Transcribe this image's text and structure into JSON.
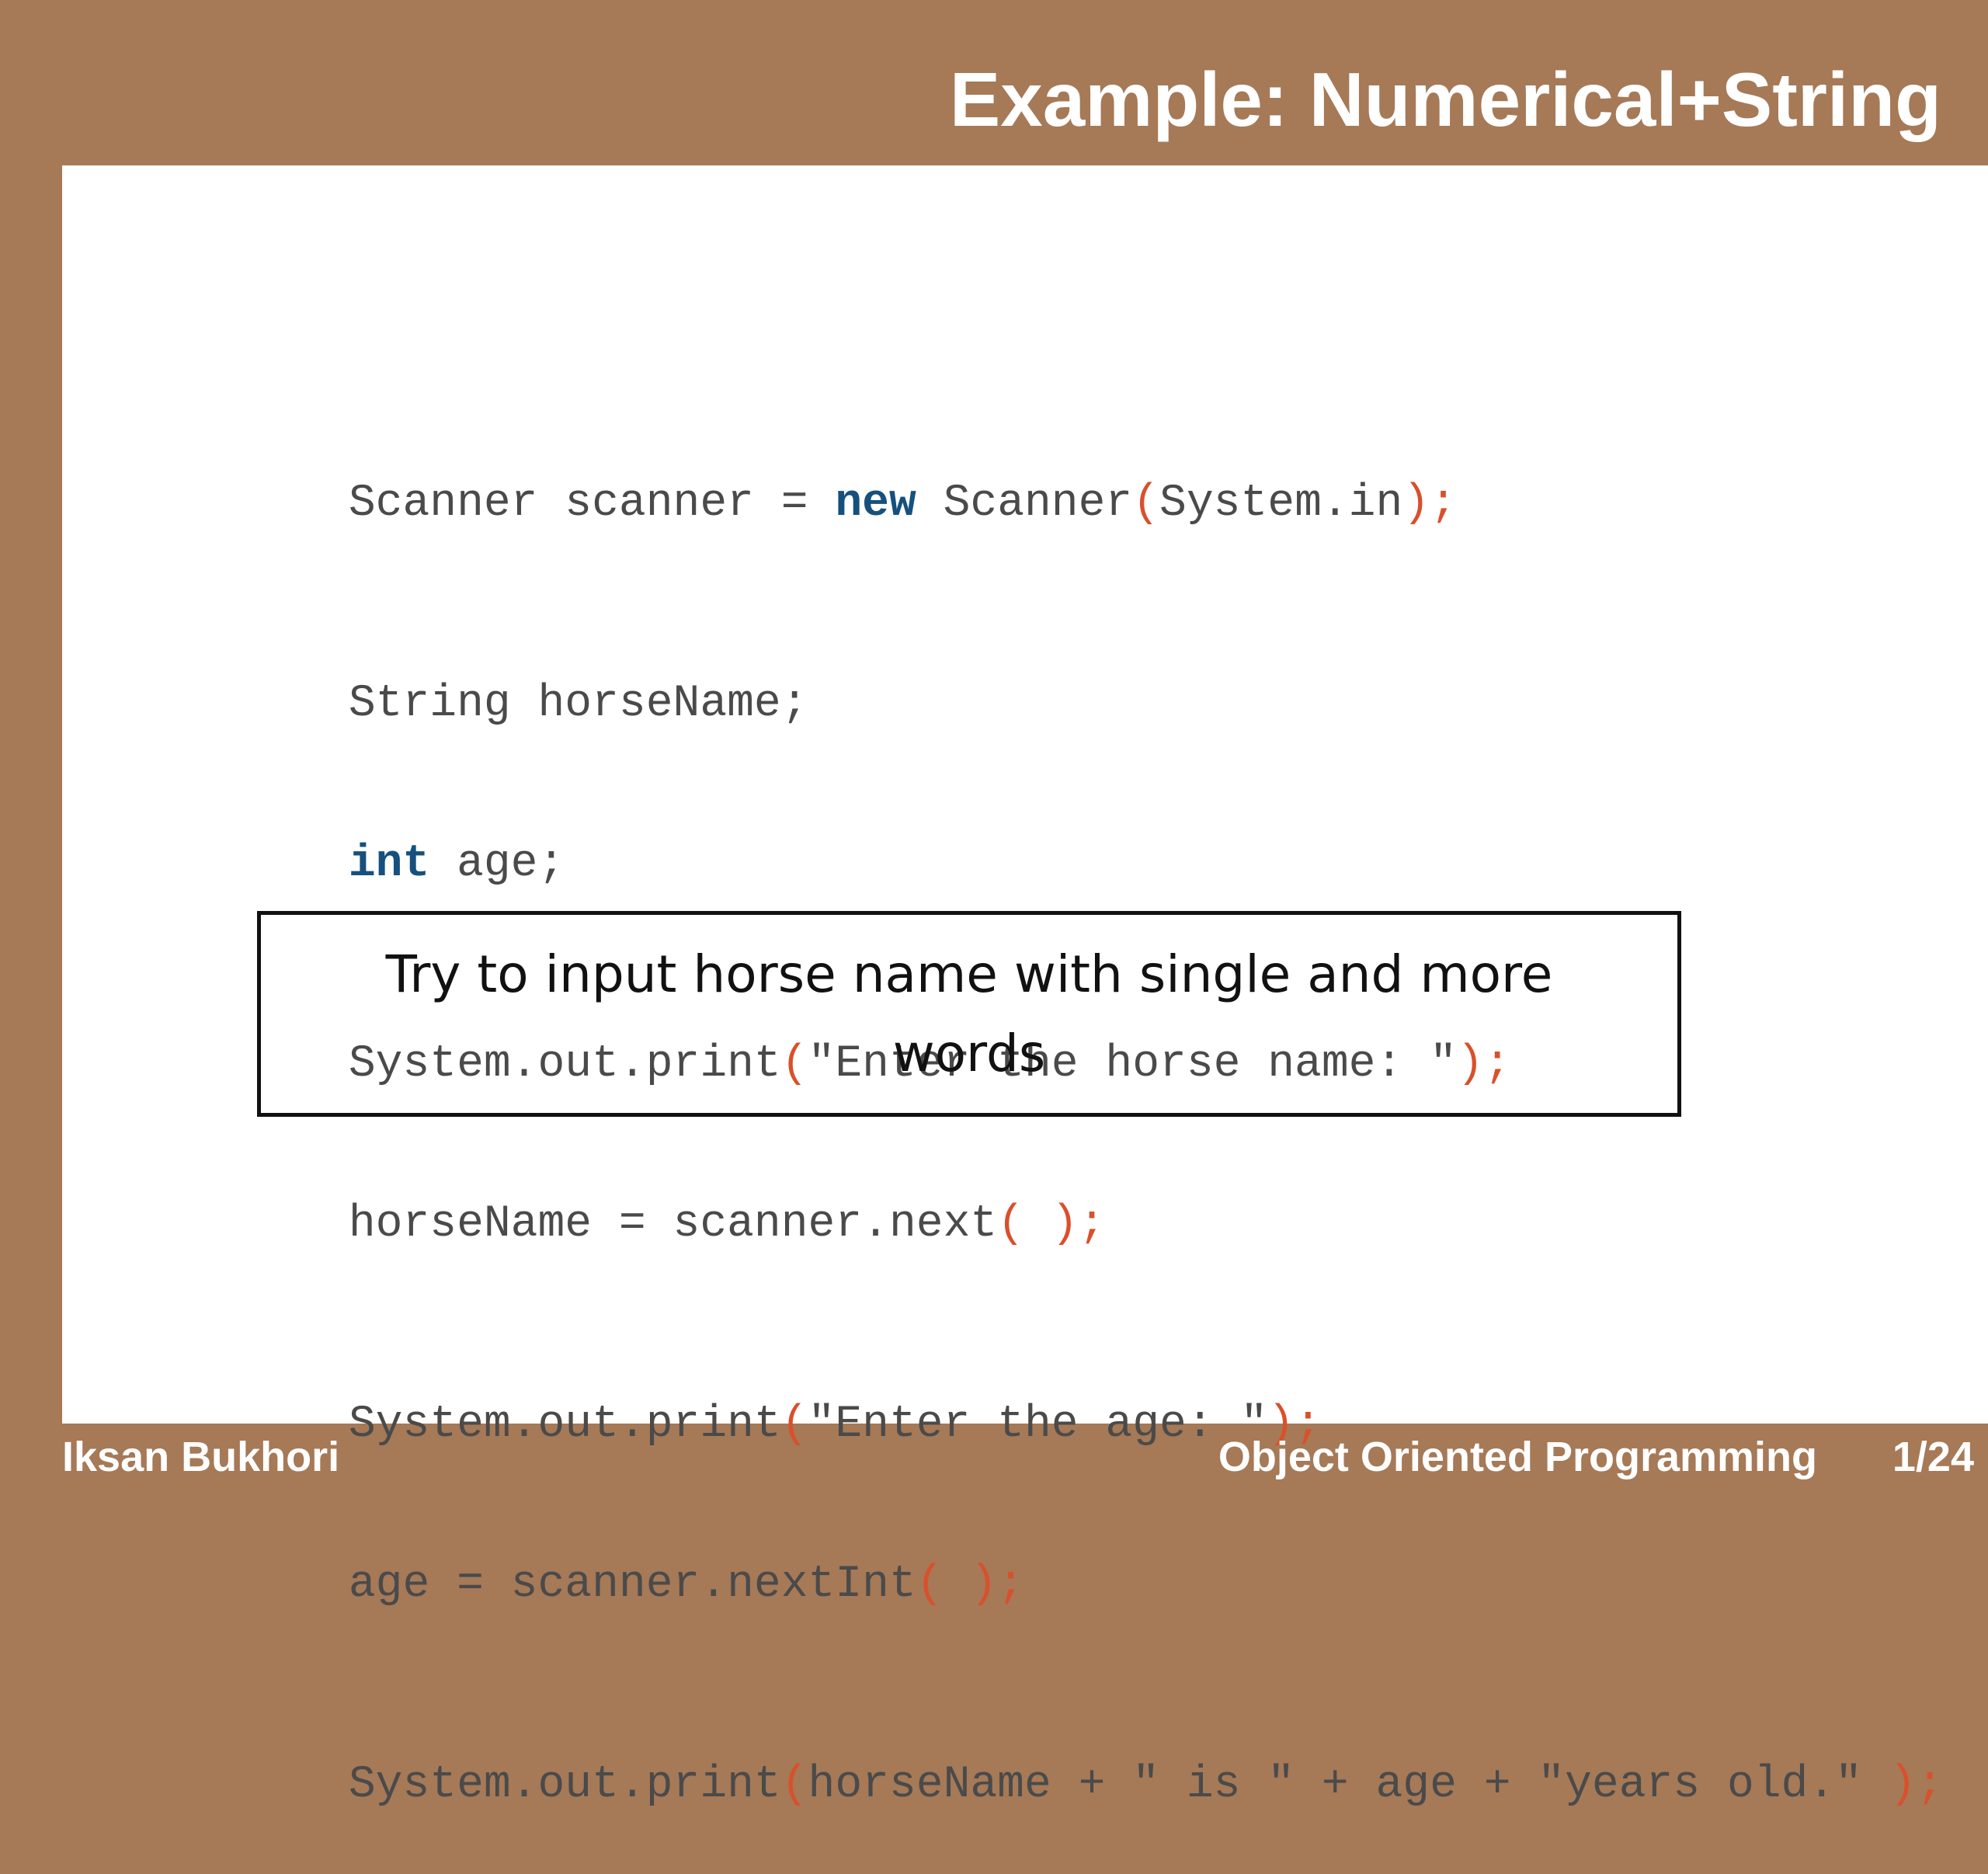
{
  "slide": {
    "title": "Example: Numerical+String"
  },
  "code": {
    "lines": [
      {
        "tokens": [
          {
            "t": "Scanner scanner = ",
            "c": "plain"
          },
          {
            "t": "new",
            "c": "kw"
          },
          {
            "t": " Scanner",
            "c": "plain"
          },
          {
            "t": "(",
            "c": "punc"
          },
          {
            "t": "System.in",
            "c": "plain"
          },
          {
            "t": ");",
            "c": "punc"
          }
        ]
      },
      {
        "tokens": [
          {
            "t": "String horseName;",
            "c": "plain"
          }
        ]
      },
      {
        "tokens": [
          {
            "t": "int",
            "c": "kw"
          },
          {
            "t": " age;",
            "c": "plain"
          }
        ]
      },
      {
        "tokens": [
          {
            "t": "System.out.print",
            "c": "plain"
          },
          {
            "t": "(",
            "c": "punc"
          },
          {
            "t": "\"Enter the horse name: \"",
            "c": "plain"
          },
          {
            "t": ");",
            "c": "punc"
          }
        ]
      },
      {
        "tokens": [
          {
            "t": "horseName = scanner.next",
            "c": "plain"
          },
          {
            "t": "( );",
            "c": "punc"
          }
        ]
      },
      {
        "tokens": [
          {
            "t": "System.out.print",
            "c": "plain"
          },
          {
            "t": "(",
            "c": "punc"
          },
          {
            "t": "\"Enter the age: \"",
            "c": "plain"
          },
          {
            "t": ");",
            "c": "punc"
          }
        ]
      },
      {
        "tokens": [
          {
            "t": "age = scanner.nextInt",
            "c": "plain"
          },
          {
            "t": "( );",
            "c": "punc"
          }
        ]
      },
      {
        "tokens": [
          {
            "t": "System.out.print",
            "c": "plain"
          },
          {
            "t": "(",
            "c": "punc"
          },
          {
            "t": "horseName + \" is \" + age + \"years old.\" ",
            "c": "plain"
          },
          {
            "t": ");",
            "c": "punc"
          }
        ]
      }
    ]
  },
  "note": {
    "text": "Try to input horse name with single and more words"
  },
  "footer": {
    "author": "Iksan Bukhori",
    "course": "Object Oriented Programming",
    "page": "1/24"
  },
  "colors": {
    "frame": "#a67957",
    "keyword": "#16507e",
    "punctuation": "#d9502b",
    "code_text": "#4a4a4a"
  }
}
